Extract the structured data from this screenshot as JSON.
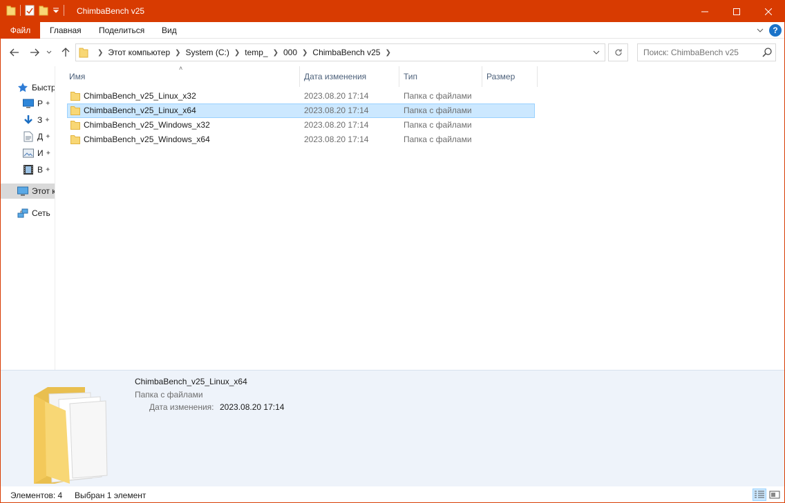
{
  "window": {
    "title": "ChimbaBench v25",
    "accent": "#d83b01"
  },
  "ribbon": {
    "tabs": [
      "Файл",
      "Главная",
      "Поделиться",
      "Вид"
    ]
  },
  "address": {
    "crumbs": [
      "Этот компьютер",
      "System (C:)",
      "temp_",
      "000",
      "ChimbaBench v25"
    ]
  },
  "search": {
    "placeholder": "Поиск: ChimbaBench v25"
  },
  "navpane": {
    "items": [
      {
        "label": "Быстр",
        "icon": "star-icon"
      },
      {
        "label": "Р",
        "icon": "desktop-icon"
      },
      {
        "label": "З",
        "icon": "download-icon"
      },
      {
        "label": "Д",
        "icon": "document-icon"
      },
      {
        "label": "И",
        "icon": "image-icon"
      },
      {
        "label": "В",
        "icon": "video-icon"
      },
      {
        "label": "Этот к",
        "icon": "computer-icon"
      },
      {
        "label": "Сеть",
        "icon": "network-icon"
      }
    ]
  },
  "filelist": {
    "columns": [
      "Имя",
      "Дата изменения",
      "Тип",
      "Размер"
    ],
    "rows": [
      {
        "name": "ChimbaBench_v25_Linux_x32",
        "date": "2023.08.20 17:14",
        "type": "Папка с файлами",
        "selected": false
      },
      {
        "name": "ChimbaBench_v25_Linux_x64",
        "date": "2023.08.20 17:14",
        "type": "Папка с файлами",
        "selected": true
      },
      {
        "name": "ChimbaBench_v25_Windows_x32",
        "date": "2023.08.20 17:14",
        "type": "Папка с файлами",
        "selected": false
      },
      {
        "name": "ChimbaBench_v25_Windows_x64",
        "date": "2023.08.20 17:14",
        "type": "Папка с файлами",
        "selected": false
      }
    ]
  },
  "details": {
    "name": "ChimbaBench_v25_Linux_x64",
    "type": "Папка с файлами",
    "modified_label": "Дата изменения:",
    "modified_value": "2023.08.20 17:14"
  },
  "status": {
    "count": "Элементов: 4",
    "selected": "Выбран 1 элемент"
  }
}
